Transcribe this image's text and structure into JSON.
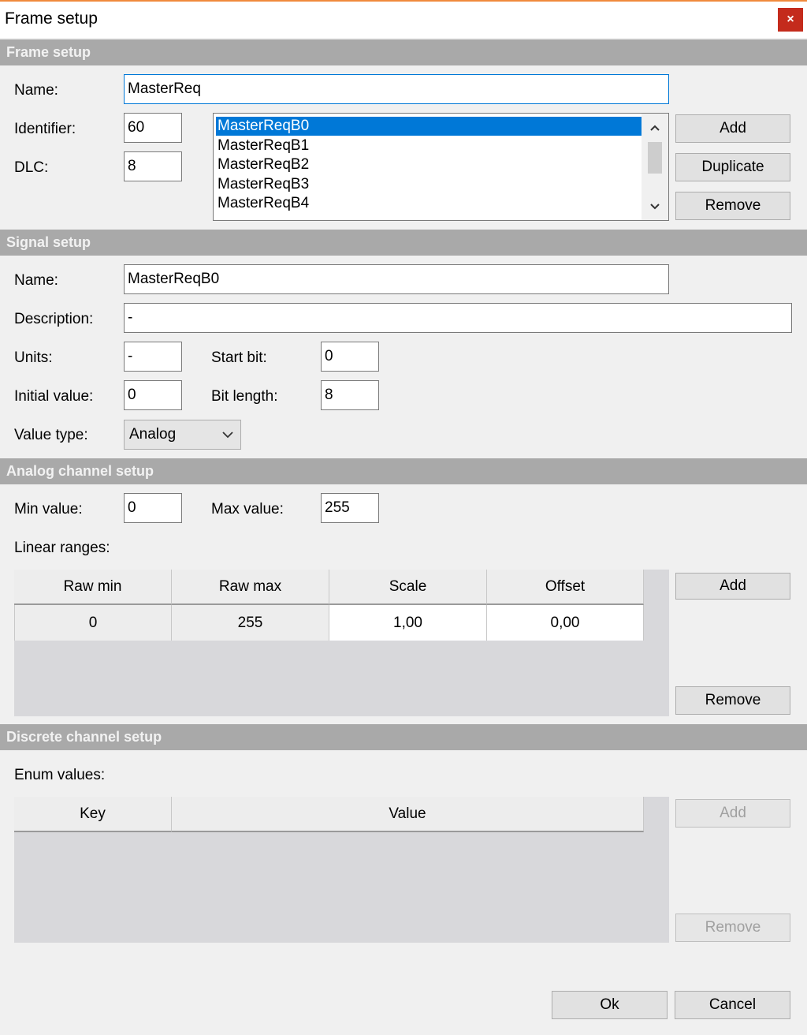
{
  "window": {
    "title": "Frame setup",
    "close": "×"
  },
  "frame": {
    "header": "Frame setup",
    "name_label": "Name:",
    "name_value": "MasterReq",
    "identifier_label": "Identifier:",
    "identifier_value": "60",
    "dlc_label": "DLC:",
    "dlc_value": "8",
    "signals": [
      "MasterReqB0",
      "MasterReqB1",
      "MasterReqB2",
      "MasterReqB3",
      "MasterReqB4"
    ],
    "selected_signal": "MasterReqB0",
    "add": "Add",
    "duplicate": "Duplicate",
    "remove": "Remove"
  },
  "signal": {
    "header": "Signal setup",
    "name_label": "Name:",
    "name_value": "MasterReqB0",
    "description_label": "Description:",
    "description_value": "-",
    "units_label": "Units:",
    "units_value": "-",
    "start_bit_label": "Start bit:",
    "start_bit_value": "0",
    "initial_label": "Initial value:",
    "initial_value": "0",
    "bit_length_label": "Bit length:",
    "bit_length_value": "8",
    "value_type_label": "Value type:",
    "value_type": "Analog"
  },
  "analog": {
    "header": "Analog channel setup",
    "min_label": "Min value:",
    "min_value": "0",
    "max_label": "Max value:",
    "max_value": "255",
    "ranges_label": "Linear ranges:",
    "columns": [
      "Raw min",
      "Raw max",
      "Scale",
      "Offset"
    ],
    "rows": [
      [
        "0",
        "255",
        "1,00",
        "0,00"
      ]
    ],
    "add": "Add",
    "remove": "Remove"
  },
  "discrete": {
    "header": "Discrete channel setup",
    "enum_label": "Enum values:",
    "columns": [
      "Key",
      "Value"
    ],
    "add": "Add",
    "remove": "Remove"
  },
  "footer": {
    "ok": "Ok",
    "cancel": "Cancel"
  },
  "colors": {
    "title_accent": "#f08a3c",
    "close_button": "#c42b1c",
    "section_header": "#a9a9a9",
    "selection": "#0078d7"
  },
  "icons": {
    "close": "close-icon",
    "scroll_up": "chevron-up-icon",
    "scroll_down": "chevron-down-icon",
    "dropdown": "chevron-down-icon"
  }
}
